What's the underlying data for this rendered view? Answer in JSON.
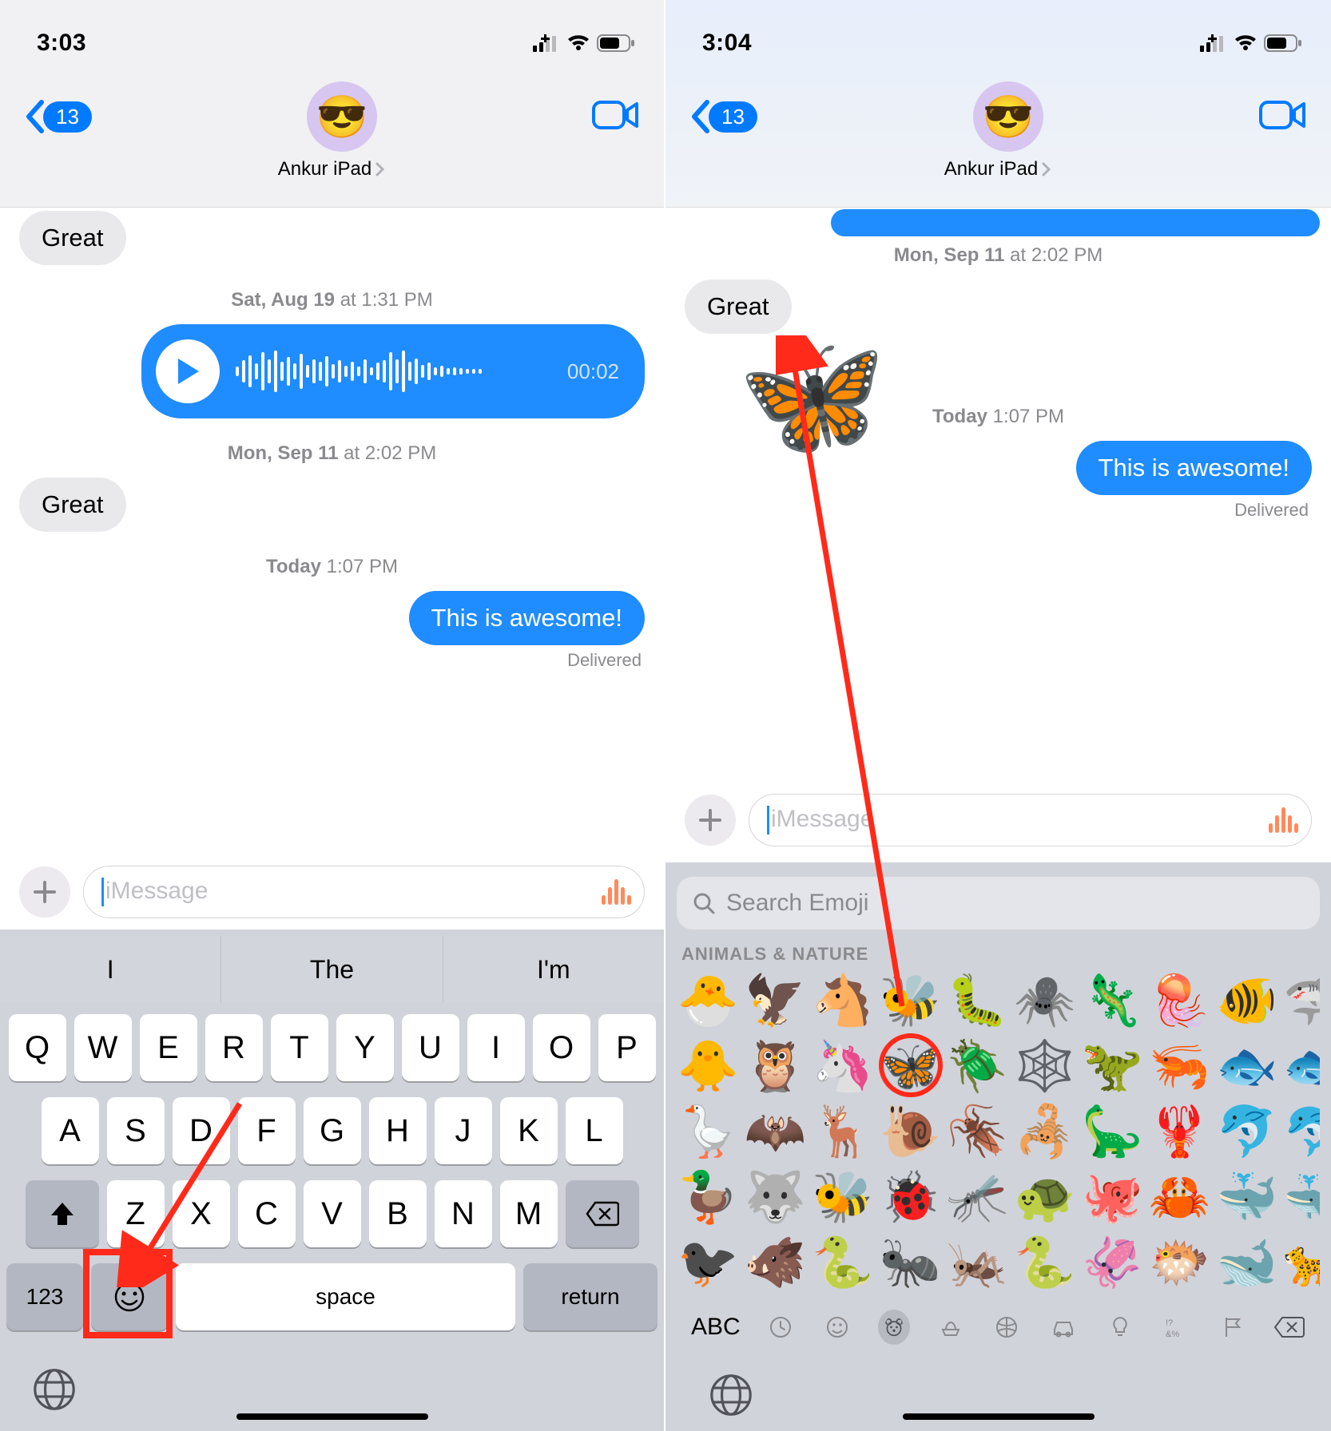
{
  "left": {
    "status_time": "3:03",
    "back_badge": "13",
    "contact_name": "Ankur iPad",
    "avatar_emoji": "😎",
    "messages": {
      "great1": "Great",
      "ts1": "Sat, Aug 19 at 1:31 PM",
      "ts1_bold": "Sat, Aug 19",
      "ts1_rest": " at 1:31 PM",
      "audio_duration": "00:02",
      "ts2_bold": "Mon, Sep 11",
      "ts2_rest": " at 2:02 PM",
      "great2": "Great",
      "ts3_bold": "Today",
      "ts3_rest": " 1:07 PM",
      "awesome": "This is awesome!",
      "delivered": "Delivered"
    },
    "compose_placeholder": "iMessage",
    "suggestions": [
      "I",
      "The",
      "I'm"
    ],
    "keys_r1": [
      "Q",
      "W",
      "E",
      "R",
      "T",
      "Y",
      "U",
      "I",
      "O",
      "P"
    ],
    "keys_r2": [
      "A",
      "S",
      "D",
      "F",
      "G",
      "H",
      "J",
      "K",
      "L"
    ],
    "keys_r3": [
      "Z",
      "X",
      "C",
      "V",
      "B",
      "N",
      "M"
    ],
    "key_123": "123",
    "key_space": "space",
    "key_return": "return"
  },
  "right": {
    "status_time": "3:04",
    "back_badge": "13",
    "contact_name": "Ankur iPad",
    "avatar_emoji": "😎",
    "ts2_bold": "Mon, Sep 11",
    "ts2_rest": " at 2:02 PM",
    "great": "Great",
    "butterfly_emoji": "🦋",
    "ts3_bold": "Today",
    "ts3_rest": " 1:07 PM",
    "awesome": "This is awesome!",
    "delivered": "Delivered",
    "compose_placeholder": "iMessage",
    "search_placeholder": "Search Emoji",
    "category_label": "ANIMALS & NATURE",
    "abc_label": "ABC",
    "emoji_rows": [
      [
        "🐣",
        "🦅",
        "🐴",
        "🐝",
        "🐛",
        "🕷️",
        "🦎",
        "🪼",
        "🐠"
      ],
      [
        "🐥",
        "🦉",
        "🦄",
        "🦋",
        "🪲",
        "🕸️",
        "🦖",
        "🦐",
        "🐟"
      ],
      [
        "🪿",
        "🦇",
        "🦌",
        "🐌",
        "🪳",
        "🦂",
        "🦕",
        "🦞",
        "🐬"
      ],
      [
        "🦆",
        "🐺",
        "🐝",
        "🐞",
        "🦟",
        "🐢",
        "🐙",
        "🦀",
        "🐳"
      ],
      [
        "🐦‍⬛",
        "🐗",
        "🐍",
        "🐜",
        "🦗",
        "🐍",
        "🦑",
        "🐡",
        "🐋"
      ]
    ],
    "emoji_partial_col": [
      "🦈",
      "🐟",
      "🐬",
      "🐳",
      "🐆"
    ]
  }
}
